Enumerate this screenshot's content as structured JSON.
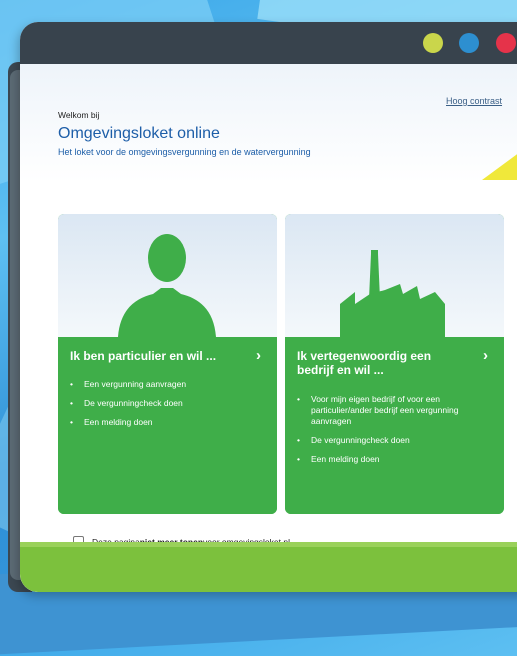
{
  "window": {
    "controls": [
      "yellow-dot",
      "blue-dot",
      "red-dot"
    ]
  },
  "header": {
    "hoog_contrast": "Hoog contrast",
    "welkom": "Welkom bij",
    "title": "Omgevingsloket online",
    "subtitle": "Het loket voor de omgevingsvergunning en de watervergunning"
  },
  "cards": [
    {
      "title": "Ik ben particulier en wil ...",
      "chevron": "›",
      "icon": "person-silhouette-icon",
      "items": [
        "Een vergunning aanvragen",
        "De vergunningcheck doen",
        "Een melding doen"
      ]
    },
    {
      "title": "Ik vertegenwoordig een bedrijf en wil ...",
      "chevron": "›",
      "icon": "factory-silhouette-icon",
      "items": [
        "Voor mijn eigen bedrijf of voor een particulier/ander bedrijf een vergunning aanvragen",
        "De vergunningcheck doen",
        "Een melding doen"
      ]
    }
  ],
  "footer": {
    "checkbox_pre": "Deze pagina ",
    "checkbox_bold": "niet meer tonen",
    "checkbox_post": " voor omgevingsloket.nl"
  },
  "colors": {
    "green": "#3fae49",
    "title_blue": "#1d5ea8",
    "titlebar": "#38434d",
    "dot_yellow": "#cad64b",
    "dot_blue": "#2d8fd0",
    "dot_red": "#e5334a",
    "footer_green": "#7cc13d"
  }
}
